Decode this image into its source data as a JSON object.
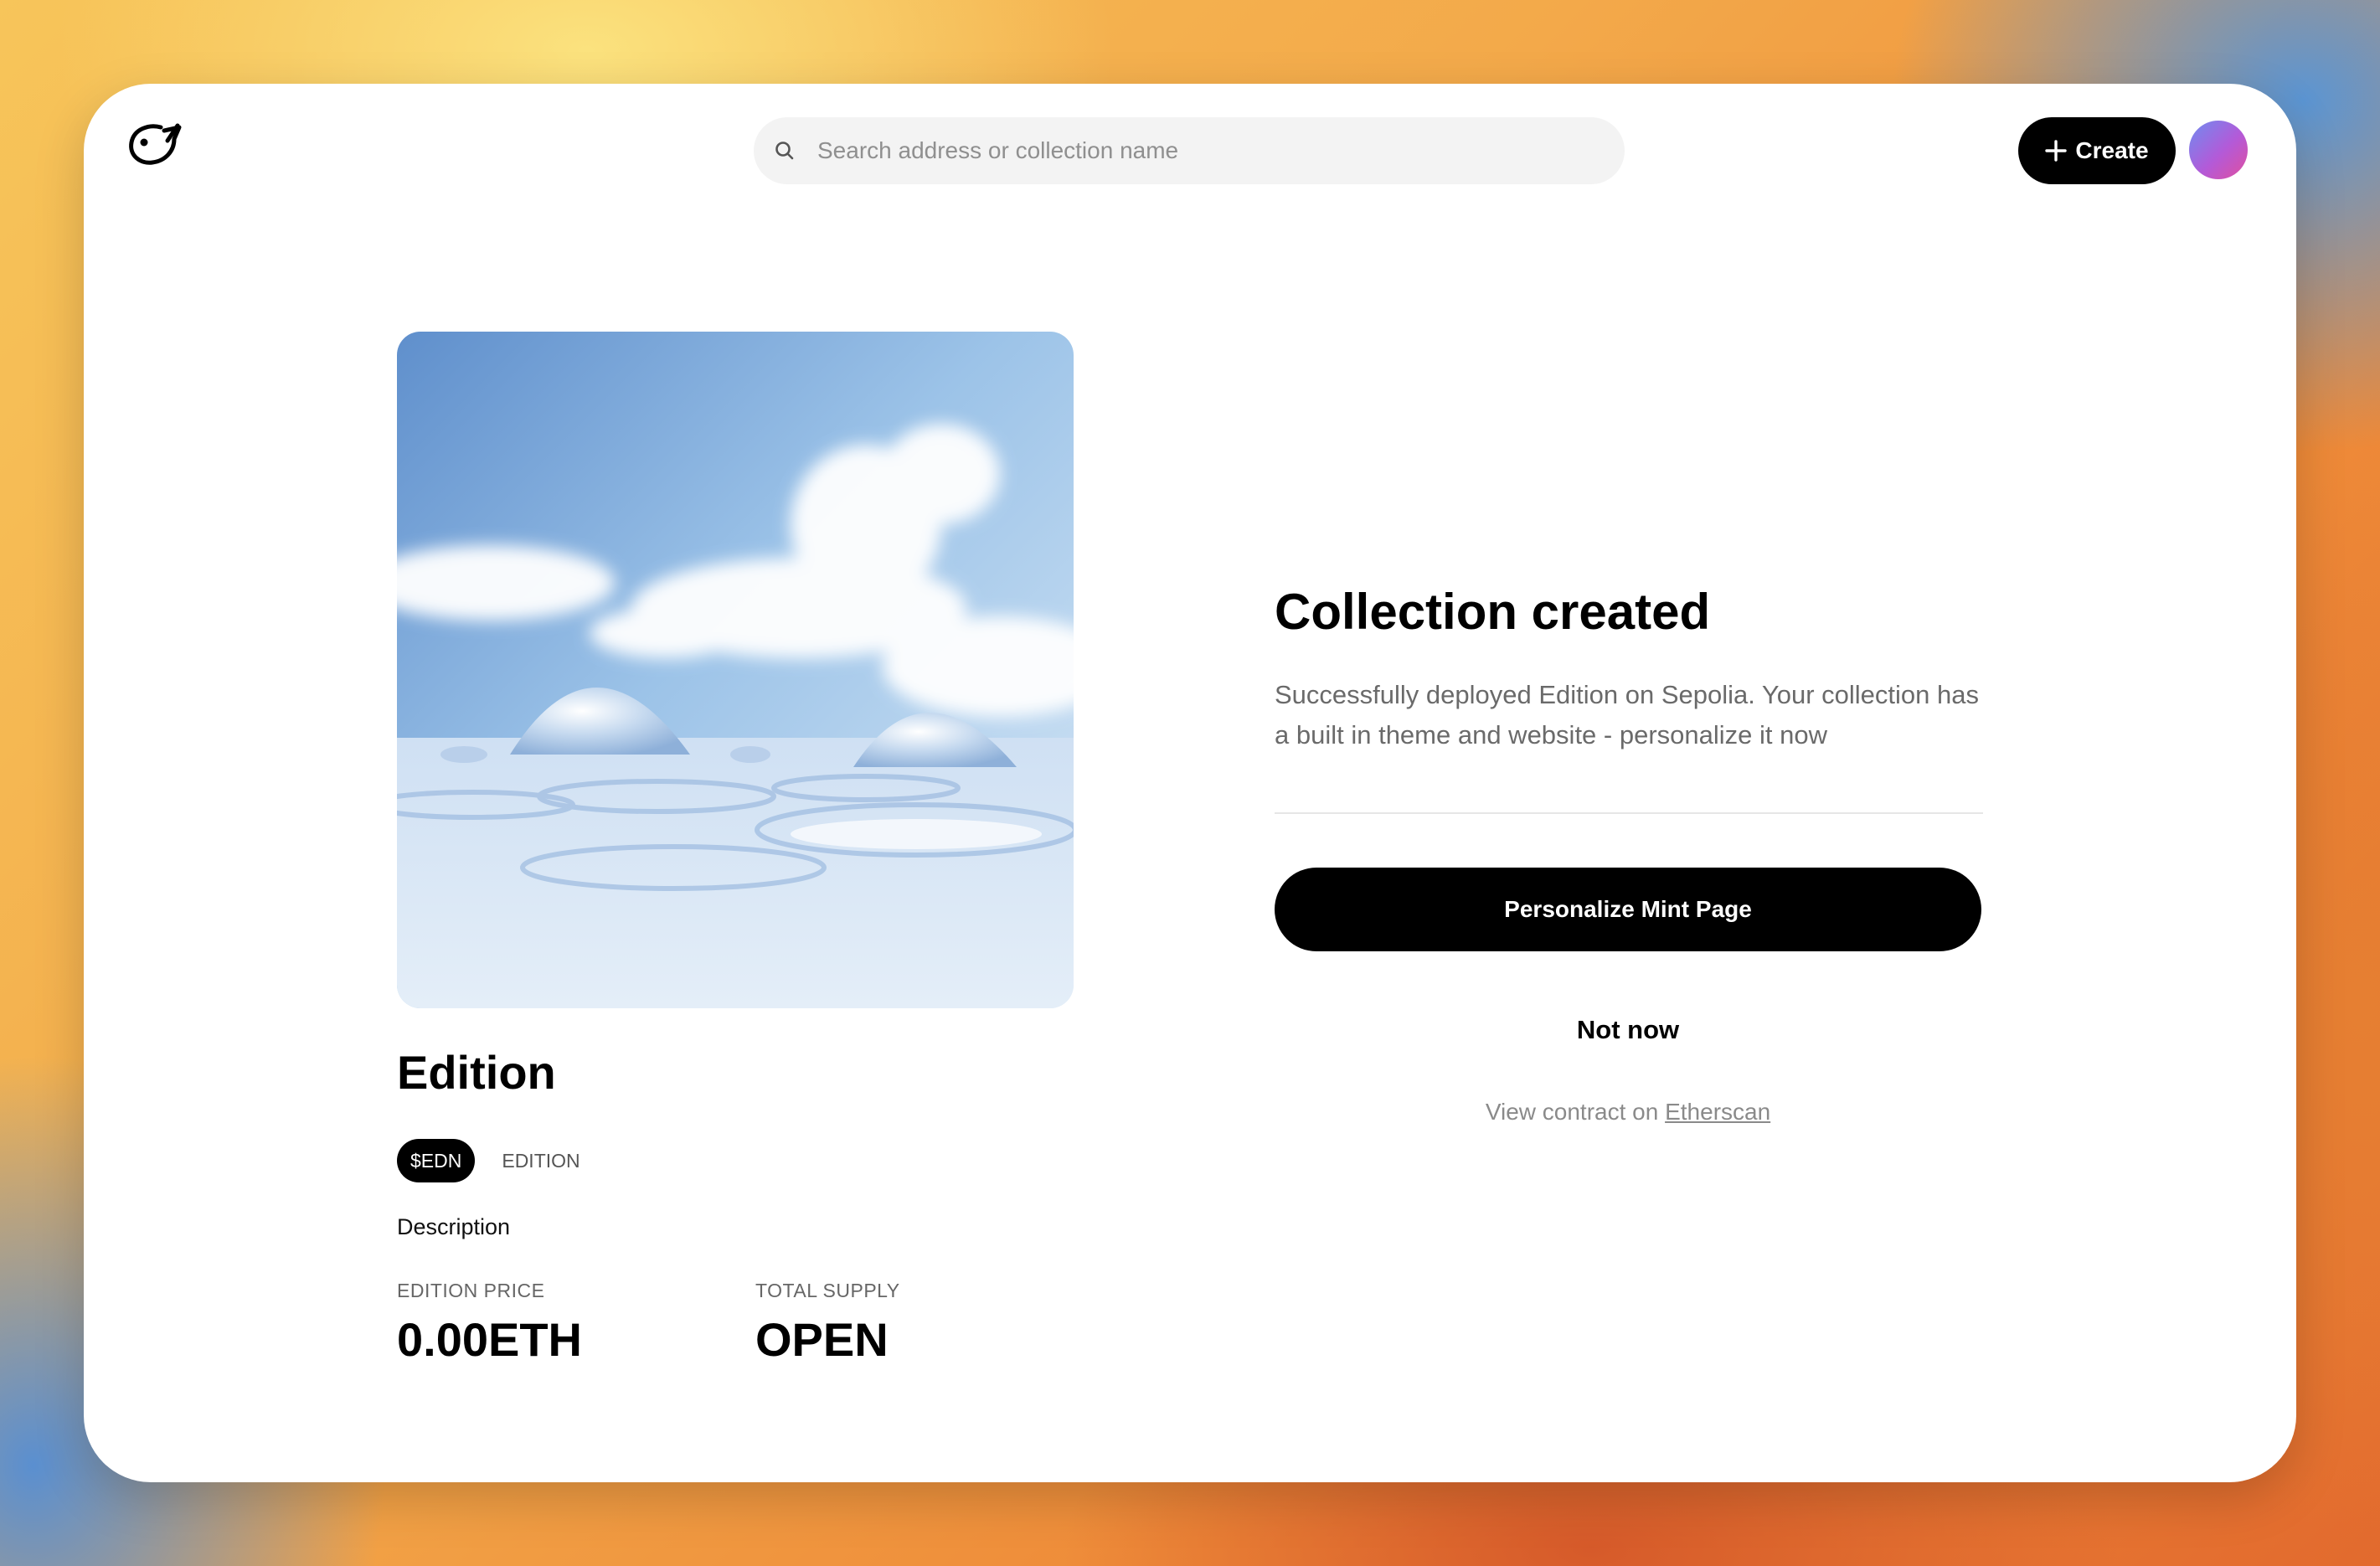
{
  "header": {
    "logo_icon": "bird-logo-icon",
    "search": {
      "icon": "search-icon",
      "placeholder": "Search address or collection name",
      "value": ""
    },
    "create_button": {
      "icon": "plus-icon",
      "label": "Create"
    },
    "avatar_icon": "user-avatar"
  },
  "collection": {
    "artwork_icon": "collection-artwork-image",
    "name": "Edition",
    "symbol": "$EDN",
    "type": "EDITION",
    "description": "Description",
    "stats": {
      "price_label": "EDITION PRICE",
      "price_value": "0.00ETH",
      "supply_label": "TOTAL SUPPLY",
      "supply_value": "OPEN"
    }
  },
  "status": {
    "title": "Collection created",
    "message": "Successfully deployed Edition on Sepolia. Your collection has a built in theme and website - personalize it now",
    "primary_button": "Personalize Mint Page",
    "secondary_button": "Not now",
    "contract_prefix": "View contract on",
    "contract_link": "Etherscan"
  },
  "colors": {
    "primary": "#000000",
    "muted_text": "#6a6a6a",
    "search_bg": "#f3f3f3"
  }
}
